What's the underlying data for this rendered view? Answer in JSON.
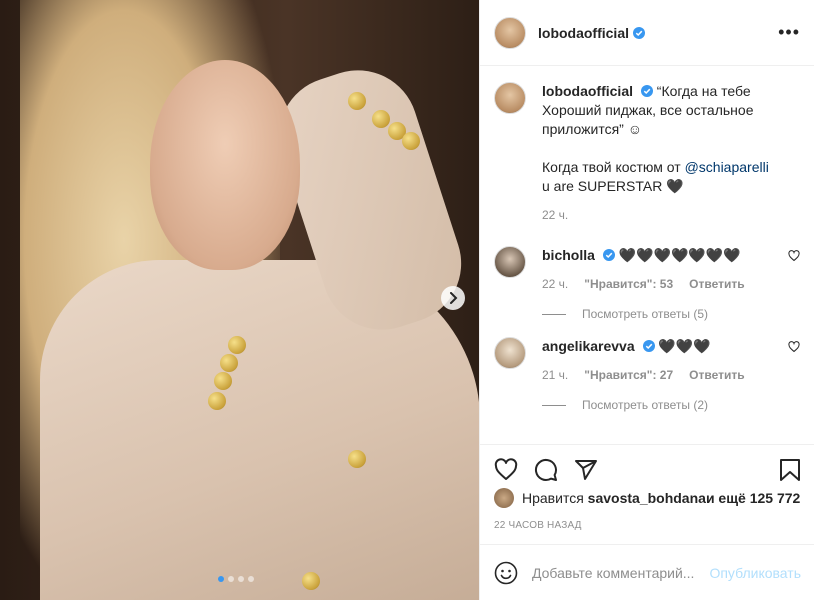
{
  "post": {
    "author": "lobodaofficial",
    "next_icon": "chevron-right-icon",
    "carousel_pages": 4,
    "carousel_active": 1
  },
  "caption": {
    "username": "lobodaofficial",
    "line1": "“Когда на тебе Хороший пиджак, все остальное приложится” ☺",
    "line2_prefix": "Когда твой костюм от ",
    "mention": "@schiaparelli",
    "line3": "u are SUPERSTAR 🖤",
    "time": "22 ч."
  },
  "comments": [
    {
      "username": "bicholla",
      "text": "🖤🖤🖤🖤🖤🖤🖤",
      "time": "22 ч.",
      "likes": "\"Нравится\": 53",
      "reply": "Ответить",
      "view_replies": "Посмотреть ответы (5)"
    },
    {
      "username": "angelikarevva",
      "text": "🖤🖤🖤",
      "time": "21 ч.",
      "likes": "\"Нравится\": 27",
      "reply": "Ответить",
      "view_replies": "Посмотреть ответы (2)"
    }
  ],
  "likes_line": {
    "prefix": "Нравится ",
    "user": "savosta_bohdana",
    "suffix": " и ещё 125 772"
  },
  "timestamp": "22 ЧАСОВ НАЗАД",
  "add_comment": {
    "placeholder": "Добавьте комментарий...",
    "post_label": "Опубликовать"
  },
  "colors": {
    "verified": "#3897f0",
    "link": "#00376b",
    "muted": "#8e8e8e",
    "post_disabled": "#b2dffc"
  }
}
